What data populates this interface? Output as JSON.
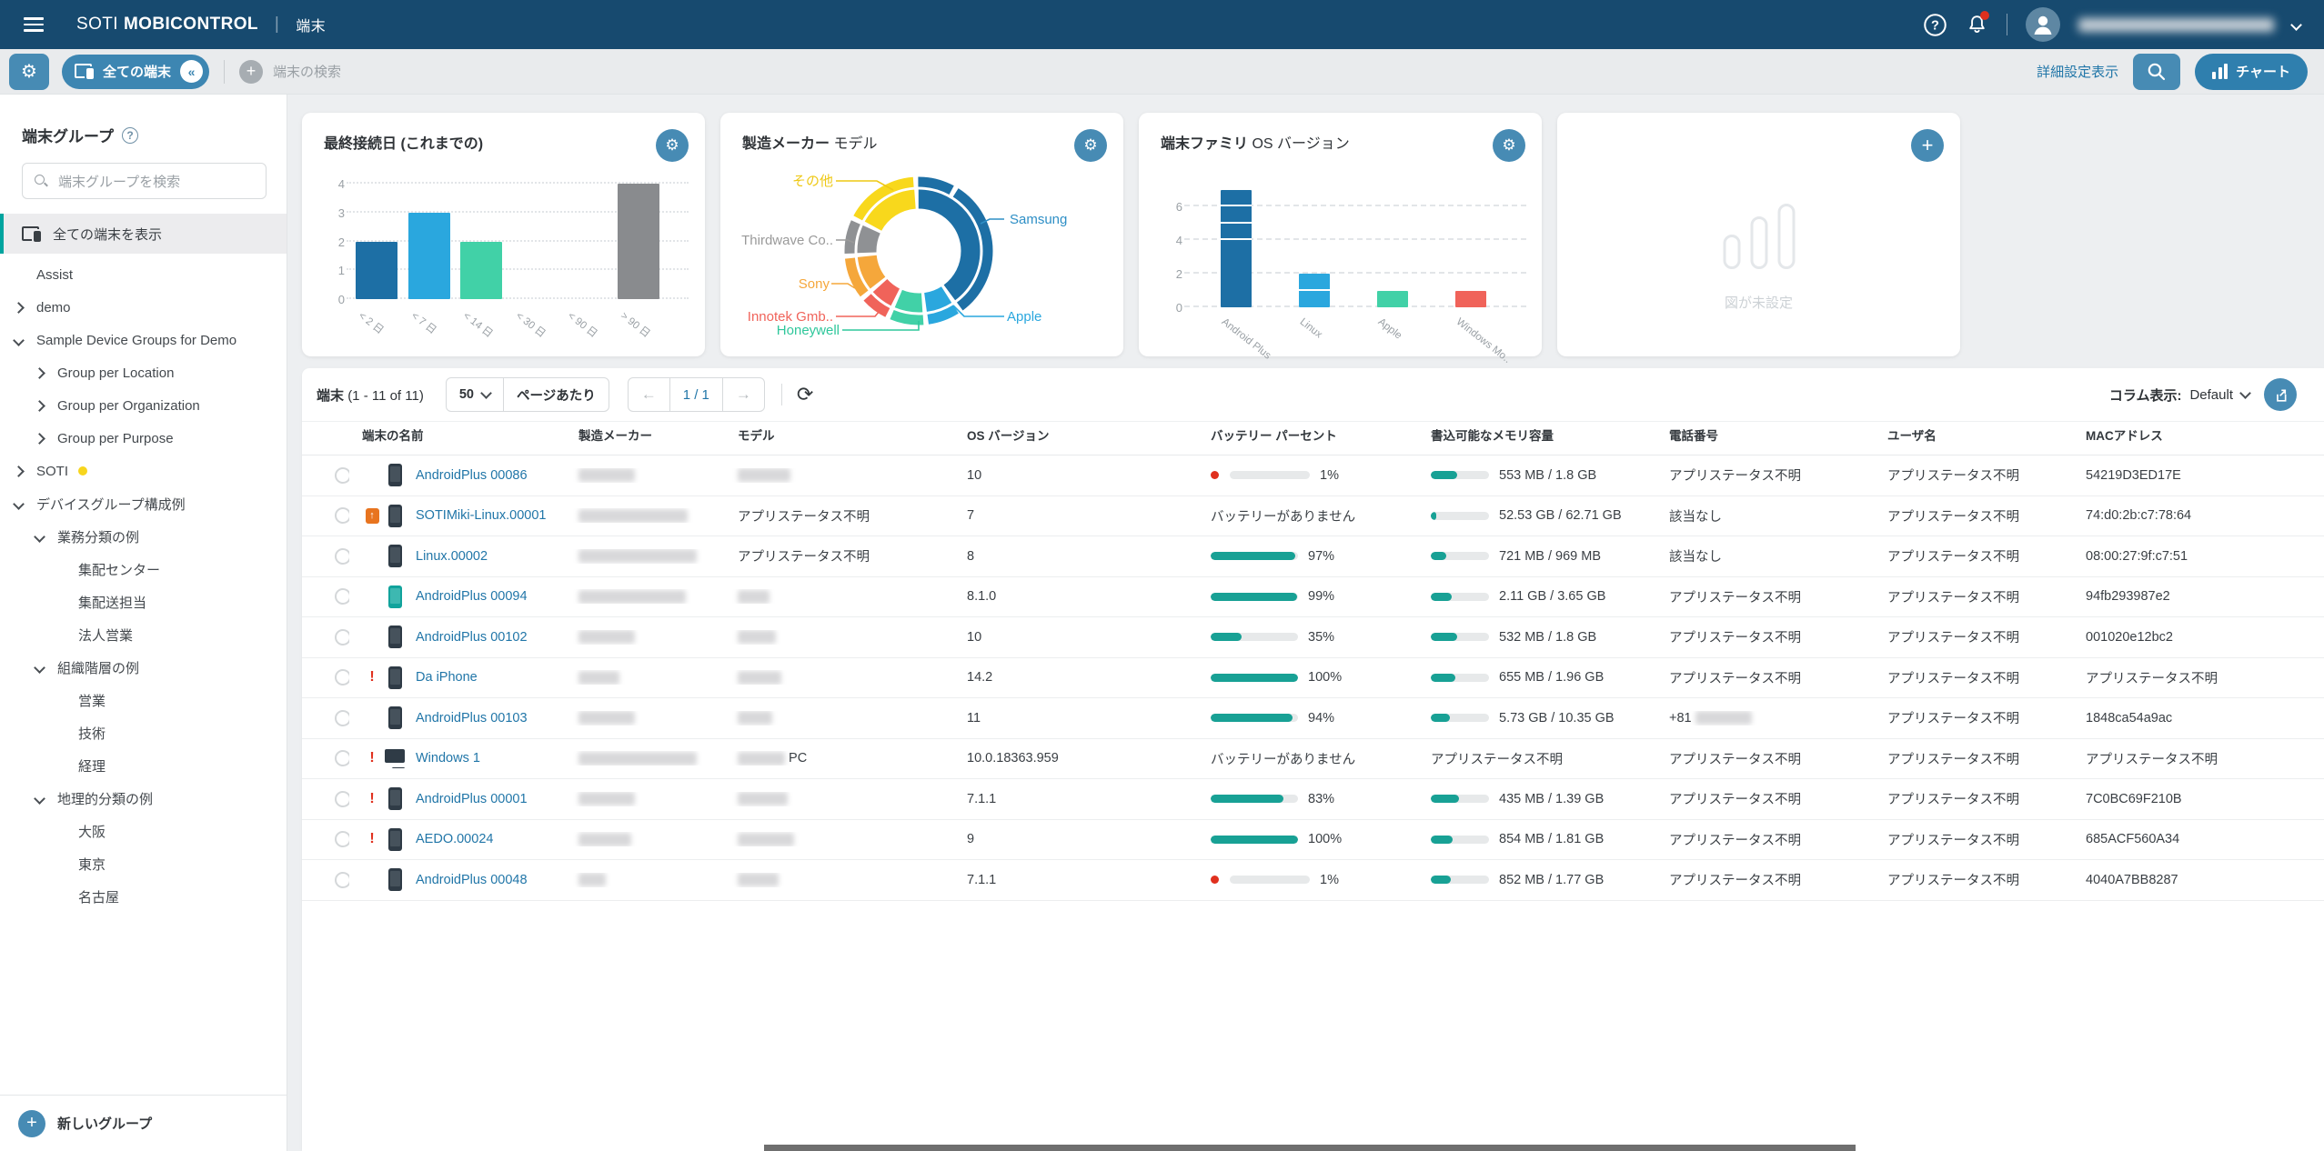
{
  "topbar": {
    "brand_light": "SOTI",
    "brand_bold": "MOBICONTROL",
    "divider": "|",
    "page_title": "端末"
  },
  "toolbar": {
    "filter_chip_label": "全ての端末",
    "chip_collapse_glyph": "«",
    "search_placeholder": "端末の検索",
    "advanced_link": "詳細設定表示",
    "chart_button_label": "チャート"
  },
  "sidebar": {
    "title": "端末グループ",
    "help_glyph": "?",
    "search_placeholder": "端末グループを検索",
    "all_devices_label": "全ての端末を表示",
    "new_group_label": "新しいグループ",
    "tree": [
      {
        "label": "Assist",
        "level": 0,
        "chevron": "none"
      },
      {
        "label": "demo",
        "level": 0,
        "chevron": "right"
      },
      {
        "label": "Sample Device Groups for Demo",
        "level": 0,
        "chevron": "down"
      },
      {
        "label": "Group per Location",
        "level": 1,
        "chevron": "right"
      },
      {
        "label": "Group per Organization",
        "level": 1,
        "chevron": "right"
      },
      {
        "label": "Group per Purpose",
        "level": 1,
        "chevron": "right"
      },
      {
        "label": "SOTI",
        "level": 0,
        "chevron": "right",
        "dot": "#f7d51d"
      },
      {
        "label": "デバイスグループ構成例",
        "level": 0,
        "chevron": "down"
      },
      {
        "label": "業務分類の例",
        "level": 1,
        "chevron": "down"
      },
      {
        "label": "集配センター",
        "level": 2,
        "chevron": "none"
      },
      {
        "label": "集配送担当",
        "level": 2,
        "chevron": "none"
      },
      {
        "label": "法人営業",
        "level": 2,
        "chevron": "none"
      },
      {
        "label": "組織階層の例",
        "level": 1,
        "chevron": "down"
      },
      {
        "label": "営業",
        "level": 2,
        "chevron": "none"
      },
      {
        "label": "技術",
        "level": 2,
        "chevron": "none"
      },
      {
        "label": "経理",
        "level": 2,
        "chevron": "none"
      },
      {
        "label": "地理的分類の例",
        "level": 1,
        "chevron": "down"
      },
      {
        "label": "大阪",
        "level": 2,
        "chevron": "none"
      },
      {
        "label": "東京",
        "level": 2,
        "chevron": "none"
      },
      {
        "label": "名古屋",
        "level": 2,
        "chevron": "none"
      }
    ]
  },
  "chart_data": [
    {
      "type": "bar",
      "title_bold": "最終接続日 (これまでの)",
      "title_rest": "",
      "categories": [
        "< 2 日",
        "< 7 日",
        "< 14 日",
        "< 30 日",
        "< 90 日",
        "> 90 日"
      ],
      "values": [
        2,
        3,
        2,
        0,
        0,
        4
      ],
      "colors": [
        "#1d6fa5",
        "#2aa7de",
        "#41d1a7",
        "#1d6fa5",
        "#2aa7de",
        "#898b8e"
      ],
      "ylim": [
        0,
        4
      ],
      "yticks": [
        0,
        1,
        2,
        3,
        4
      ],
      "grid": "dotted"
    },
    {
      "type": "donut",
      "title_bold": "製造メーカー",
      "title_rest": "モデル",
      "rings": "outer=manufacturer, inner=model",
      "segments": [
        {
          "label": "Samsung",
          "value": 41,
          "color": "#1d6fa5",
          "label_color": "#2e8fc6",
          "side": "right"
        },
        {
          "label": "Apple",
          "value": 8,
          "color": "#2aa7de",
          "label_color": "#2aa7de",
          "side": "right"
        },
        {
          "label": "Honeywell",
          "value": 8.5,
          "color": "#41d1a7",
          "label_color": "#2fc79b",
          "side": "left"
        },
        {
          "label": "Innotek Gmb..",
          "value": 7,
          "color": "#f0635a",
          "label_color": "#f0635a",
          "side": "left"
        },
        {
          "label": "Sony",
          "value": 10,
          "color": "#f5a73b",
          "label_color": "#f5a73b",
          "side": "left"
        },
        {
          "label": "Thirdwave Co..",
          "value": 8.5,
          "color": "#8f9194",
          "label_color": "#9a9a9a",
          "side": "left"
        },
        {
          "label": "その他",
          "value": 17,
          "color": "#f8d81c",
          "label_color": "#eec814",
          "side": "left"
        }
      ],
      "outer_splits": {
        "0": [
          9,
          32
        ]
      }
    },
    {
      "type": "stacked-bar",
      "title_bold": "端末ファミリ",
      "title_rest": "OS バージョン",
      "categories": [
        "Android Plus",
        "Linux",
        "Apple",
        "Windows Mo.."
      ],
      "series_segments": [
        [
          4,
          1,
          1,
          1
        ],
        [
          1,
          1
        ],
        [
          1
        ],
        [
          1
        ]
      ],
      "totals": [
        7,
        2,
        1,
        1
      ],
      "colors": [
        "#1d6fa5",
        "#2aa7de",
        "#41d1a7",
        "#f0635a"
      ],
      "ylim": [
        0,
        7.3
      ],
      "yticks": [
        0,
        2,
        4,
        6
      ],
      "grid": "dashed"
    },
    {
      "type": "empty",
      "placeholder": "図が未設定"
    }
  ],
  "table": {
    "summary_bold": "端末",
    "summary_rest": "(1 - 11 of 11)",
    "page_size": "50",
    "per_page_label": "ページあたり",
    "prev_glyph": "←",
    "next_glyph": "→",
    "page_indicator": "1 / 1",
    "refresh_glyph": "⟳",
    "columns_label": "コラム表示:",
    "columns_value": "Default",
    "headers": [
      "端末の名前",
      "製造メーカー",
      "モデル",
      "OS バージョン",
      "バッテリー パーセント",
      "書込可能なメモリ容量",
      "電話番号",
      "ユーザ名",
      "MACアドレス"
    ],
    "rows": [
      {
        "alert": "",
        "icon": "phone",
        "name": "AndroidPlus 00086",
        "mfr": {
          "blur": 62
        },
        "model": {
          "blur": 58
        },
        "os": "10",
        "bat": {
          "low": true,
          "label": "1%"
        },
        "mem": {
          "pct": 45,
          "label": "553 MB / 1.8 GB"
        },
        "tel": "アプリステータス不明",
        "user": "アプリステータス不明",
        "mac": "54219D3ED17E"
      },
      {
        "alert": "assist",
        "icon": "phone",
        "name": "SOTIMiki-Linux.00001",
        "mfr": {
          "blur": 120
        },
        "model": {
          "text": "アプリステータス不明"
        },
        "os": "7",
        "bat": {
          "label": "バッテリーがありません"
        },
        "mem": {
          "pct": 9,
          "label": "52.53 GB / 62.71 GB"
        },
        "tel": "該当なし",
        "user": "アプリステータス不明",
        "mac": "74:d0:2b:c7:78:64"
      },
      {
        "alert": "",
        "icon": "phone",
        "name": "Linux.00002",
        "mfr": {
          "blur": 130
        },
        "model": {
          "text": "アプリステータス不明"
        },
        "os": "8",
        "bat": {
          "pct": 97,
          "label": "97%"
        },
        "mem": {
          "pct": 26,
          "label": "721 MB / 969 MB"
        },
        "tel": "該当なし",
        "user": "アプリステータス不明",
        "mac": "08:00:27:9f:c7:51"
      },
      {
        "alert": "",
        "icon": "phone-teal",
        "name": "AndroidPlus 00094",
        "mfr": {
          "blur": 118
        },
        "model": {
          "blur": 35
        },
        "os": "8.1.0",
        "bat": {
          "pct": 99,
          "label": "99%"
        },
        "mem": {
          "pct": 36,
          "label": "2.11 GB / 3.65 GB"
        },
        "tel": "アプリステータス不明",
        "user": "アプリステータス不明",
        "mac": "94fb293987e2"
      },
      {
        "alert": "",
        "icon": "phone",
        "name": "AndroidPlus 00102",
        "mfr": {
          "blur": 62
        },
        "model": {
          "blur": 42
        },
        "os": "10",
        "bat": {
          "pct": 35,
          "label": "35%"
        },
        "mem": {
          "pct": 45,
          "label": "532 MB / 1.8 GB"
        },
        "tel": "アプリステータス不明",
        "user": "アプリステータス不明",
        "mac": "001020e12bc2"
      },
      {
        "alert": "error",
        "icon": "phone",
        "name": "Da iPhone",
        "mfr": {
          "blur": 45
        },
        "model": {
          "blur": 48
        },
        "os": "14.2",
        "bat": {
          "pct": 100,
          "label": "100%"
        },
        "mem": {
          "pct": 42,
          "label": "655 MB / 1.96 GB"
        },
        "tel": "アプリステータス不明",
        "user": "アプリステータス不明",
        "mac": "アプリステータス不明"
      },
      {
        "alert": "",
        "icon": "phone",
        "name": "AndroidPlus 00103",
        "mfr": {
          "blur": 62
        },
        "model": {
          "blur": 38
        },
        "os": "11",
        "bat": {
          "pct": 94,
          "label": "94%"
        },
        "mem": {
          "pct": 33,
          "label": "5.73 GB / 10.35 GB"
        },
        "tel": {
          "prefix": "+81",
          "blur": 62
        },
        "user": "アプリステータス不明",
        "mac": "1848ca54a9ac"
      },
      {
        "alert": "error",
        "icon": "monitor",
        "name": "Windows 1",
        "mfr": {
          "blur": 130
        },
        "model": {
          "blur": 52,
          "suffix": "PC"
        },
        "os": "10.0.18363.959",
        "bat": {
          "label": "バッテリーがありません"
        },
        "mem": {
          "text": "アプリステータス不明"
        },
        "tel": "アプリステータス不明",
        "user": "アプリステータス不明",
        "mac": "アプリステータス不明"
      },
      {
        "alert": "error",
        "icon": "phone",
        "name": "AndroidPlus 00001",
        "mfr": {
          "blur": 62
        },
        "model": {
          "blur": 55
        },
        "os": "7.1.1",
        "bat": {
          "pct": 83,
          "label": "83%"
        },
        "mem": {
          "pct": 48,
          "label": "435 MB / 1.39 GB"
        },
        "tel": "アプリステータス不明",
        "user": "アプリステータス不明",
        "mac": "7C0BC69F210B"
      },
      {
        "alert": "error",
        "icon": "phone",
        "name": "AEDO.00024",
        "mfr": {
          "blur": 58
        },
        "model": {
          "blur": 62
        },
        "os": "9",
        "bat": {
          "pct": 100,
          "label": "100%"
        },
        "mem": {
          "pct": 38,
          "label": "854 MB / 1.81 GB"
        },
        "tel": "アプリステータス不明",
        "user": "アプリステータス不明",
        "mac": "685ACF560A34"
      },
      {
        "alert": "",
        "icon": "phone",
        "name": "AndroidPlus 00048",
        "mfr": {
          "blur": 30
        },
        "model": {
          "blur": 45
        },
        "os": "7.1.1",
        "bat": {
          "low": true,
          "label": "1%"
        },
        "mem": {
          "pct": 35,
          "label": "852 MB / 1.77 GB"
        },
        "tel": "アプリステータス不明",
        "user": "アプリステータス不明",
        "mac": "4040A7BB8287"
      }
    ]
  }
}
